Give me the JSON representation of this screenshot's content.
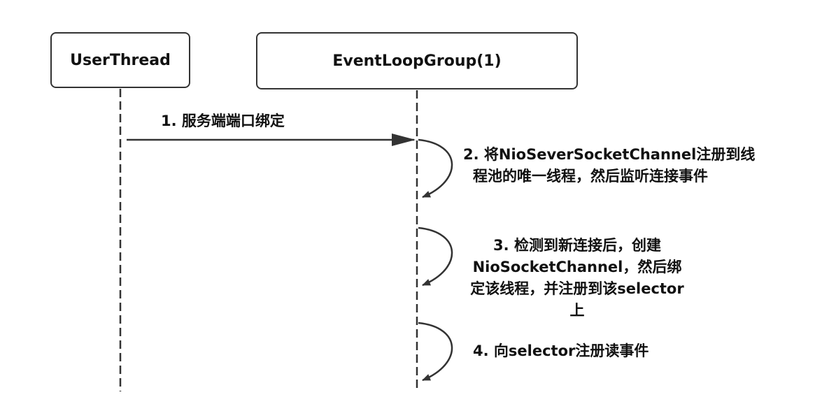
{
  "participants": [
    {
      "id": "user_thread",
      "label": "UserThread"
    },
    {
      "id": "event_loop_group",
      "label": "EventLoopGroup(1)"
    }
  ],
  "messages": [
    {
      "from": "user_thread",
      "to": "event_loop_group",
      "lines": [
        "1. 服务端端口绑定"
      ]
    },
    {
      "from": "event_loop_group",
      "to": "event_loop_group",
      "lines": [
        "2. 将NioSeverSocketChannel注册到线",
        "程池的唯一线程，然后监听连接事件"
      ]
    },
    {
      "from": "event_loop_group",
      "to": "event_loop_group",
      "lines": [
        "3.  检测到新连接后，创建",
        "NioSocketChannel，然后绑",
        "定该线程，并注册到该selector",
        "上"
      ]
    },
    {
      "from": "event_loop_group",
      "to": "event_loop_group",
      "lines": [
        "4. 向selector注册读事件"
      ]
    }
  ],
  "colors": {
    "stroke": "#333333",
    "text": "#111111",
    "background": "#ffffff"
  }
}
